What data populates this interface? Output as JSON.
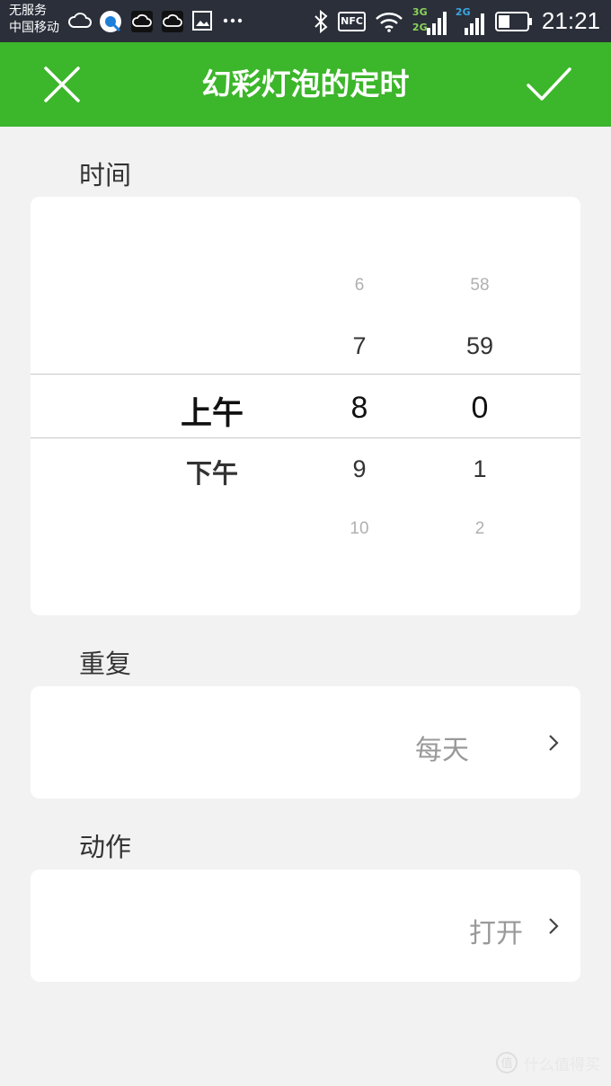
{
  "status_bar": {
    "carrier_line1": "无服务",
    "carrier_line2": "中国移动",
    "nfc": "NFC",
    "net_3g": "3G",
    "net_2g_a": "2G",
    "net_2g_b": "2G",
    "time": "21:21"
  },
  "header": {
    "title": "幻彩灯泡的定时"
  },
  "time_section": {
    "label": "时间",
    "ampm": {
      "selected": "上午",
      "next": "下午"
    },
    "hours": {
      "far_above": "6",
      "above": "7",
      "selected": "8",
      "below": "9",
      "far_below": "10"
    },
    "minutes": {
      "far_above": "58",
      "above": "59",
      "selected": "0",
      "below": "1",
      "far_below": "2"
    }
  },
  "repeat_section": {
    "label": "重复",
    "value": "每天"
  },
  "action_section": {
    "label": "动作",
    "value": "打开"
  },
  "watermark": {
    "text": "什么值得买"
  },
  "colors": {
    "header_bg": "#3cb62a",
    "statusbar_bg": "#2a2f3a",
    "page_bg": "#f2f2f2"
  }
}
